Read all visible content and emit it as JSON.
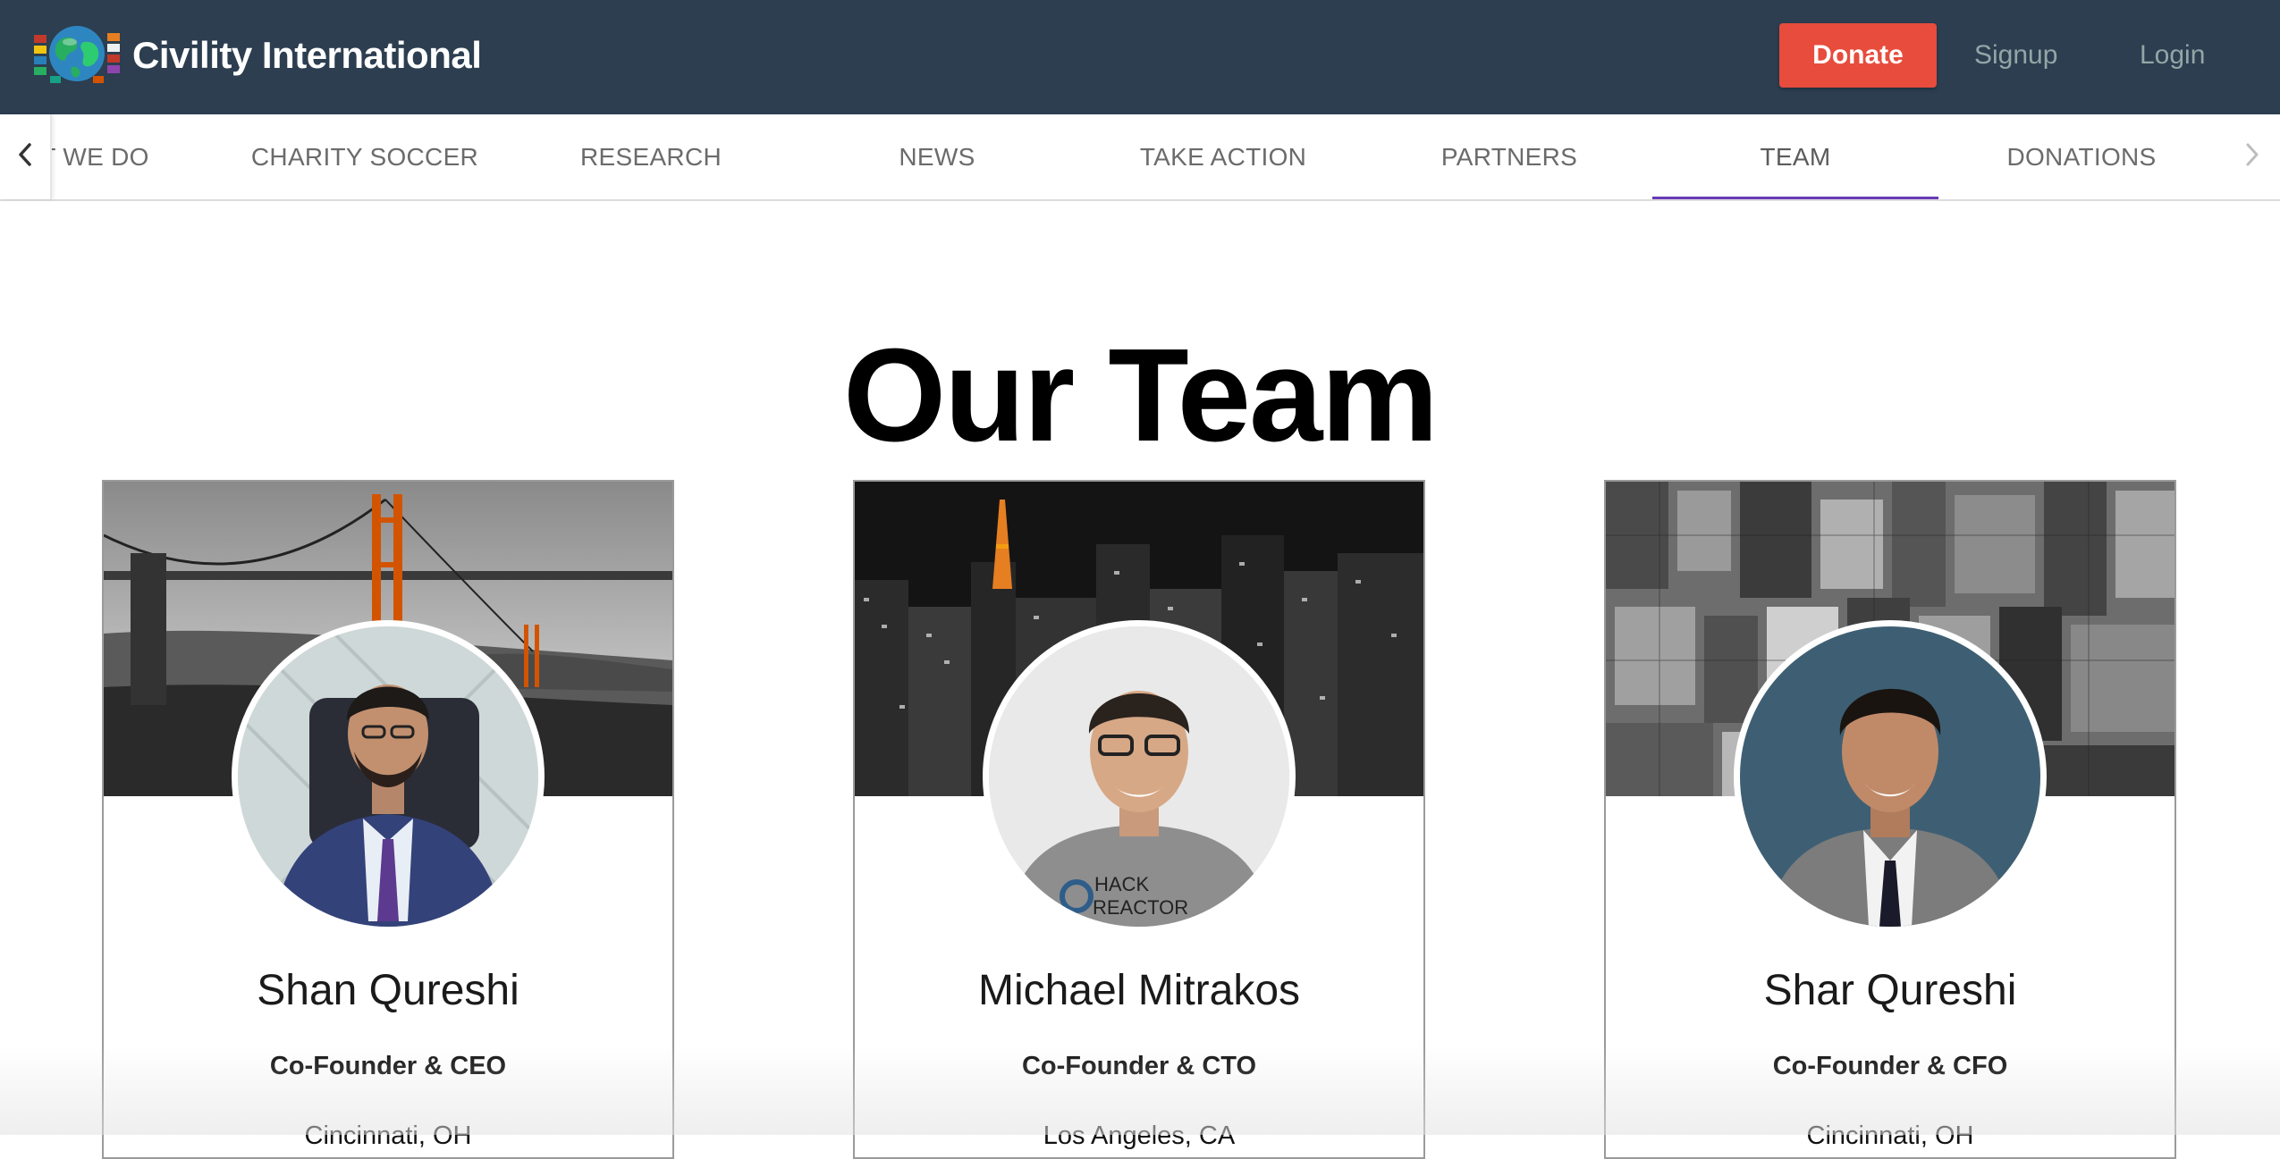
{
  "header": {
    "brand": "Civility International",
    "logo_icon": "globe-flags-logo",
    "donate_label": "Donate",
    "signup_label": "Signup",
    "login_label": "Login",
    "colors": {
      "bar": "#2c3e50",
      "donate": "#e74c3c",
      "muted_link": "#95a5a6"
    }
  },
  "tabs": {
    "items": [
      {
        "label": "WHAT WE DO"
      },
      {
        "label": "CHARITY SOCCER"
      },
      {
        "label": "RESEARCH"
      },
      {
        "label": "NEWS"
      },
      {
        "label": "TAKE ACTION"
      },
      {
        "label": "PARTNERS"
      },
      {
        "label": "TEAM"
      },
      {
        "label": "DONATIONS"
      }
    ],
    "active": "TEAM",
    "indicator_color": "#673ab7",
    "left_arrow_icon": "chevron-left-icon",
    "right_arrow_icon": "chevron-right-icon"
  },
  "page": {
    "title": "Our Team"
  },
  "team": [
    {
      "name": "Shan Qureshi",
      "role": "Co-Founder & CEO",
      "location": "Cincinnati, OH",
      "cover": "golden-gate-bridge-image",
      "photo": "profile-photo"
    },
    {
      "name": "Michael Mitrakos",
      "role": "Co-Founder & CTO",
      "location": "Los Angeles, CA",
      "cover": "night-city-skyline-image",
      "photo": "profile-photo",
      "shirt_text": "HACK REACTOR"
    },
    {
      "name": "Shar Qureshi",
      "role": "Co-Founder & CFO",
      "location": "Cincinnati, OH",
      "cover": "aerial-city-image",
      "photo": "profile-photo"
    }
  ]
}
